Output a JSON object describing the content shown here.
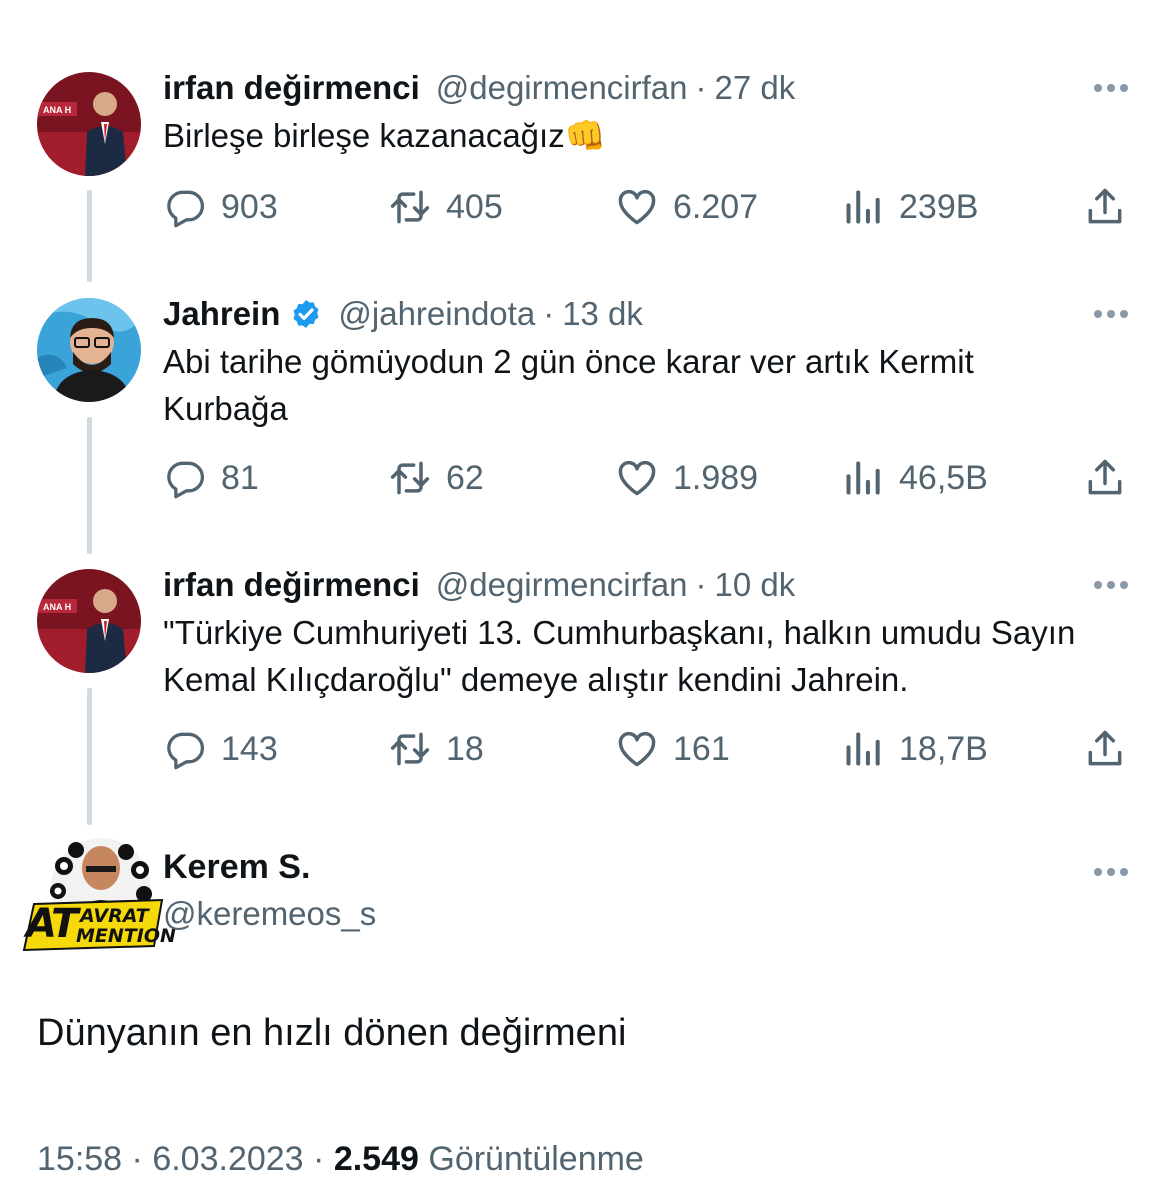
{
  "tweets": [
    {
      "display_name": "irfan değirmenci",
      "handle": "@degirmencirfan",
      "separator": "·",
      "time": "27 dk",
      "verified": false,
      "text": "Birleşe birleşe kazanacağız👊",
      "replies": "903",
      "retweets": "405",
      "likes": "6.207",
      "views": "239B"
    },
    {
      "display_name": "Jahrein",
      "handle": "@jahreindota",
      "separator": "·",
      "time": "13 dk",
      "verified": true,
      "text": "Abi tarihe gömüyodun 2 gün önce karar ver artık Kermit Kurbağa",
      "replies": "81",
      "retweets": "62",
      "likes": "1.989",
      "views": "46,5B"
    },
    {
      "display_name": "irfan değirmenci",
      "handle": "@degirmencirfan",
      "separator": "·",
      "time": "10 dk",
      "verified": false,
      "text": "\"Türkiye Cumhuriyeti 13. Cumhurbaşkanı, halkın umudu Sayın Kemal Kılıçdaroğlu\" demeye alıştır kendini Jahrein.",
      "replies": "143",
      "retweets": "18",
      "likes": "161",
      "views": "18,7B"
    }
  ],
  "main_tweet": {
    "display_name": "Kerem S.",
    "handle": "@keremeos_s",
    "avatar_badge_line1": "AT",
    "avatar_badge_line2a": "AVRAT",
    "avatar_badge_line2b": "MENTION",
    "text": "Dünyanın en hızlı dönen değirmeni",
    "time": "15:58",
    "separator1": "·",
    "date": "6.03.2023",
    "separator2": "·",
    "view_count": "2.549",
    "views_label": "Görüntülenme"
  },
  "colors": {
    "text_primary": "#0f1419",
    "text_secondary": "#536471",
    "thread_line": "#cfd9de",
    "verified_blue": "#1d9bf0"
  },
  "icons": [
    "reply-icon",
    "retweet-icon",
    "like-icon",
    "views-icon",
    "share-icon",
    "more-icon",
    "verified-icon"
  ]
}
